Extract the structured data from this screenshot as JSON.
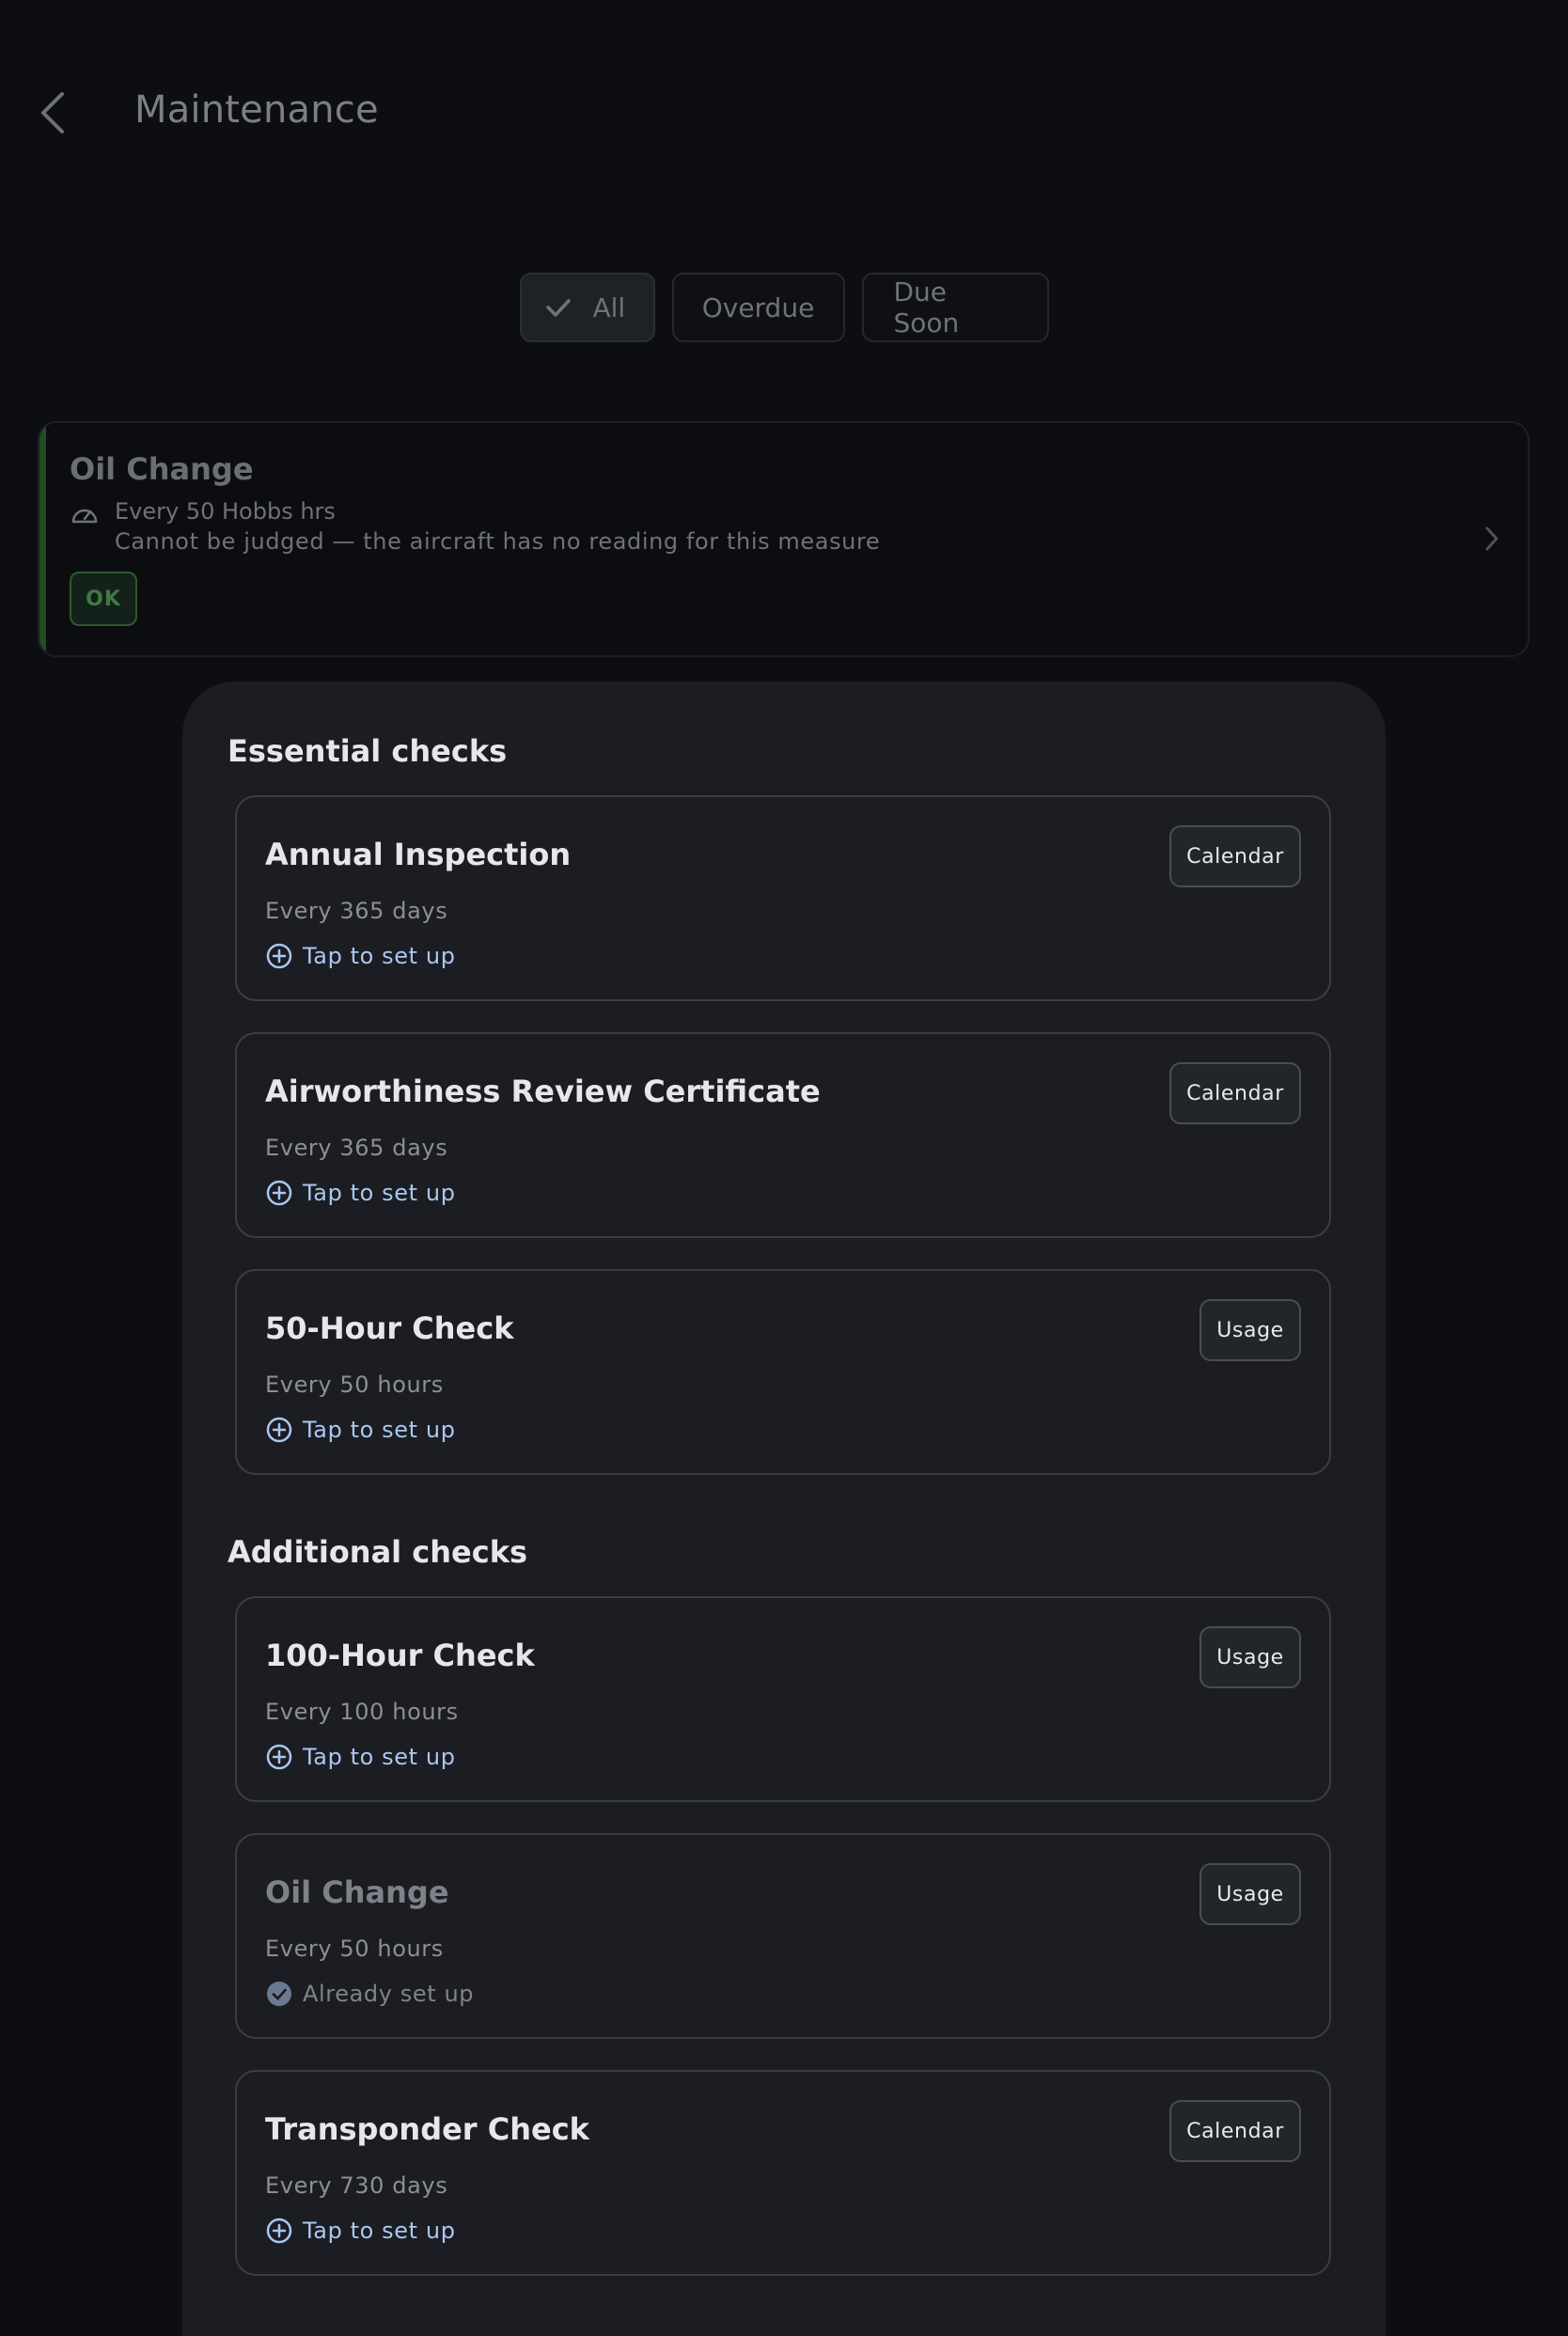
{
  "header": {
    "title": "Maintenance",
    "back_icon": "chevron-left-icon"
  },
  "filters": [
    {
      "label": "All",
      "selected": true
    },
    {
      "label": "Overdue",
      "selected": false
    },
    {
      "label": "Due Soon",
      "selected": false
    }
  ],
  "background_item": {
    "title": "Oil Change",
    "interval": "Every 50 Hobbs hrs",
    "note": "Cannot be judged — the aircraft has no reading for this measure",
    "status": "OK",
    "icon": "gauge-icon"
  },
  "sheet": {
    "essential_title": "Essential checks",
    "additional_title": "Additional checks",
    "essential": [
      {
        "title": "Annual Inspection",
        "interval": "Every 365 days",
        "action": "Tap to set up",
        "tag": "Calendar",
        "set_up": false
      },
      {
        "title": "Airworthiness Review Certificate",
        "interval": "Every 365 days",
        "action": "Tap to set up",
        "tag": "Calendar",
        "set_up": false
      },
      {
        "title": "50-Hour Check",
        "interval": "Every 50 hours",
        "action": "Tap to set up",
        "tag": "Usage",
        "set_up": false
      }
    ],
    "additional": [
      {
        "title": "100-Hour Check",
        "interval": "Every 100 hours",
        "action": "Tap to set up",
        "tag": "Usage",
        "set_up": false
      },
      {
        "title": "Oil Change",
        "interval": "Every 50 hours",
        "action": "Already set up",
        "tag": "Usage",
        "set_up": true
      },
      {
        "title": "Transponder Check",
        "interval": "Every 730 days",
        "action": "Tap to set up",
        "tag": "Calendar",
        "set_up": false
      }
    ]
  },
  "colors": {
    "background": "#0d0e12",
    "sheet": "#1b1d22",
    "link": "#a9c7f0",
    "ok_green": "#3f7a44"
  }
}
